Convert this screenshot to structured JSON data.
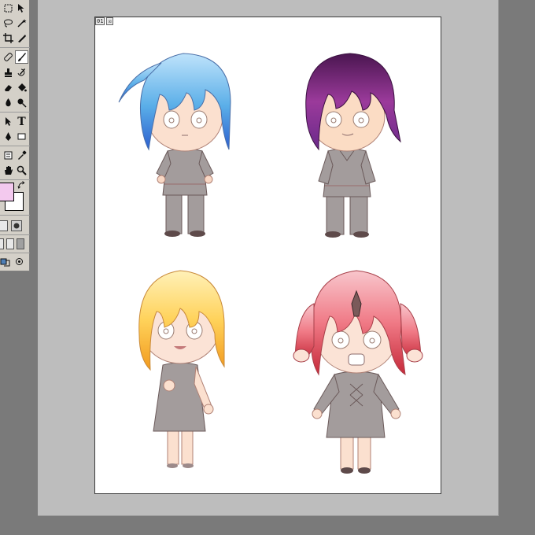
{
  "document": {
    "tags": [
      "01",
      "☒"
    ]
  },
  "colors": {
    "foreground": "#f3c9ee",
    "background": "#ffffff",
    "workspace": "#bdbdbd",
    "outer": "#7a7a7a"
  },
  "toolbox": {
    "tools": [
      "marquee-tool",
      "move-tool",
      "lasso-tool",
      "magic-wand-tool",
      "crop-tool",
      "slice-tool",
      "healing-brush-tool",
      "brush-tool",
      "clone-stamp-tool",
      "history-brush-tool",
      "eraser-tool",
      "paint-bucket-tool",
      "blur-tool",
      "dodge-tool",
      "path-selection-tool",
      "type-tool",
      "pen-tool",
      "shape-tool",
      "notes-tool",
      "eyedropper-tool",
      "hand-tool",
      "zoom-tool"
    ],
    "type_tool_label": "T"
  },
  "artwork": {
    "characters": [
      {
        "id": "blue-hair-boy",
        "hair": "#5aaee8",
        "hair_dark": "#2c5fcf",
        "outfit": "#9c9494"
      },
      {
        "id": "purple-hair-boy",
        "hair": "#8a2f8a",
        "hair_dark": "#3f1146",
        "outfit": "#9c9494"
      },
      {
        "id": "blonde-girl",
        "hair": "#ffd25a",
        "hair_dark": "#f29a1e",
        "outfit": "#9c9494"
      },
      {
        "id": "pink-hair-girl",
        "hair": "#f07a86",
        "hair_dark": "#c62a3a",
        "outfit": "#9c9494"
      }
    ]
  }
}
